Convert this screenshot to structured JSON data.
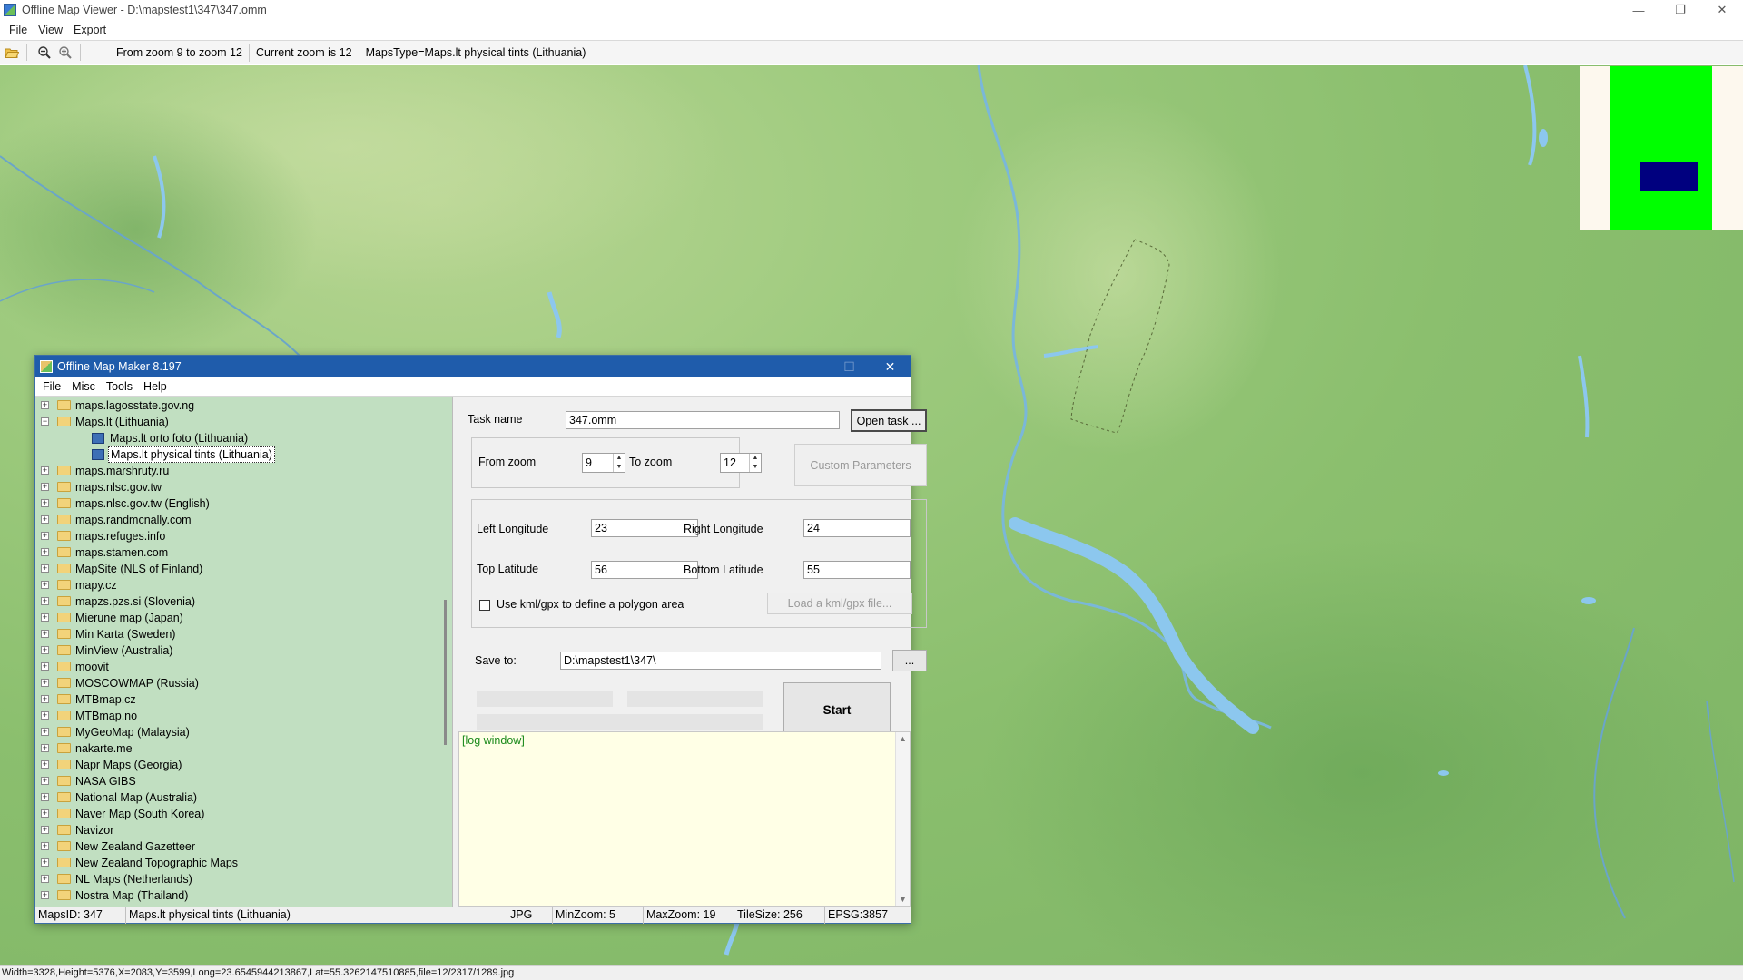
{
  "window": {
    "title": "Offline Map Viewer - D:\\mapstest1\\347\\347.omm",
    "minimize_glyph": "—",
    "restore_glyph": "❐",
    "close_glyph": "✕"
  },
  "menu": [
    "File",
    "View",
    "Export"
  ],
  "toolbar": {
    "zoom_range": "From zoom 9 to zoom 12",
    "current_zoom": "Current zoom is 12",
    "maps_type": "MapsType=Maps.lt physical tints (Lithuania)"
  },
  "status": "Width=3328,Height=5376,X=2083,Y=3599,Long=23.6545944213867,Lat=55.3262147510885,file=12/2317/1289.jpg",
  "maker": {
    "title": "Offline Map Maker 8.197",
    "menu": [
      "File",
      "Misc",
      "Tools",
      "Help"
    ],
    "tree": [
      {
        "label": "maps.lagosstate.gov.ng",
        "level": 0,
        "type": "folder",
        "expander": "+"
      },
      {
        "label": "Maps.lt (Lithuania)",
        "level": 0,
        "type": "folder-open",
        "expander": "−"
      },
      {
        "label": "Maps.lt orto foto (Lithuania)",
        "level": 1,
        "type": "map",
        "expander": ""
      },
      {
        "label": "Maps.lt physical tints (Lithuania)",
        "level": 1,
        "type": "map",
        "expander": "",
        "selected": true
      },
      {
        "label": "maps.marshruty.ru",
        "level": 0,
        "type": "folder",
        "expander": "+"
      },
      {
        "label": "maps.nlsc.gov.tw",
        "level": 0,
        "type": "folder",
        "expander": "+"
      },
      {
        "label": "maps.nlsc.gov.tw (English)",
        "level": 0,
        "type": "folder",
        "expander": "+"
      },
      {
        "label": "maps.randmcnally.com",
        "level": 0,
        "type": "folder",
        "expander": "+"
      },
      {
        "label": "maps.refuges.info",
        "level": 0,
        "type": "folder",
        "expander": "+"
      },
      {
        "label": "maps.stamen.com",
        "level": 0,
        "type": "folder",
        "expander": "+"
      },
      {
        "label": "MapSite (NLS of Finland)",
        "level": 0,
        "type": "folder",
        "expander": "+"
      },
      {
        "label": "mapy.cz",
        "level": 0,
        "type": "folder",
        "expander": "+"
      },
      {
        "label": "mapzs.pzs.si (Slovenia)",
        "level": 0,
        "type": "folder",
        "expander": "+"
      },
      {
        "label": "Mierune map (Japan)",
        "level": 0,
        "type": "folder",
        "expander": "+"
      },
      {
        "label": "Min Karta (Sweden)",
        "level": 0,
        "type": "folder",
        "expander": "+"
      },
      {
        "label": "MinView (Australia)",
        "level": 0,
        "type": "folder",
        "expander": "+"
      },
      {
        "label": "moovit",
        "level": 0,
        "type": "folder",
        "expander": "+"
      },
      {
        "label": "MOSCOWMAP (Russia)",
        "level": 0,
        "type": "folder",
        "expander": "+"
      },
      {
        "label": "MTBmap.cz",
        "level": 0,
        "type": "folder",
        "expander": "+"
      },
      {
        "label": "MTBmap.no",
        "level": 0,
        "type": "folder",
        "expander": "+"
      },
      {
        "label": "MyGeoMap (Malaysia)",
        "level": 0,
        "type": "folder",
        "expander": "+"
      },
      {
        "label": "nakarte.me",
        "level": 0,
        "type": "folder",
        "expander": "+"
      },
      {
        "label": "Napr Maps (Georgia)",
        "level": 0,
        "type": "folder",
        "expander": "+"
      },
      {
        "label": "NASA GIBS",
        "level": 0,
        "type": "folder",
        "expander": "+"
      },
      {
        "label": "National Map (Australia)",
        "level": 0,
        "type": "folder",
        "expander": "+"
      },
      {
        "label": "Naver Map (South Korea)",
        "level": 0,
        "type": "folder",
        "expander": "+"
      },
      {
        "label": "Navizor",
        "level": 0,
        "type": "folder",
        "expander": "+"
      },
      {
        "label": "New Zealand Gazetteer",
        "level": 0,
        "type": "folder",
        "expander": "+"
      },
      {
        "label": "New Zealand Topographic Maps",
        "level": 0,
        "type": "folder",
        "expander": "+"
      },
      {
        "label": "NL Maps (Netherlands)",
        "level": 0,
        "type": "folder",
        "expander": "+"
      },
      {
        "label": "Nostra Map (Thailand)",
        "level": 0,
        "type": "folder",
        "expander": "+"
      }
    ],
    "task_name_label": "Task name",
    "task_name": "347.omm",
    "open_task": "Open task ...",
    "from_zoom_label": "From zoom",
    "from_zoom": "9",
    "to_zoom_label": "To zoom",
    "to_zoom": "12",
    "custom_params": "Custom Parameters",
    "left_lon_label": "Left Longitude",
    "left_lon": "23",
    "right_lon_label": "Right Longitude",
    "right_lon": "24",
    "top_lat_label": "Top Latitude",
    "top_lat": "56",
    "bottom_lat_label": "Bottom Latitude",
    "bottom_lat": "55",
    "kml_label": "Use kml/gpx to define a polygon area",
    "load_kml": "Load a kml/gpx file...",
    "save_to_label": "Save to:",
    "save_to": "D:\\mapstest1\\347\\",
    "browse": "...",
    "start": "Start",
    "log": "[log window]",
    "status": {
      "maps_id": "MapsID: 347",
      "maps_name": "Maps.lt physical tints (Lithuania)",
      "format": "JPG",
      "min_zoom": "MinZoom: 5",
      "max_zoom": "MaxZoom: 19",
      "tile_size": "TileSize: 256",
      "epsg": "EPSG:3857"
    }
  }
}
